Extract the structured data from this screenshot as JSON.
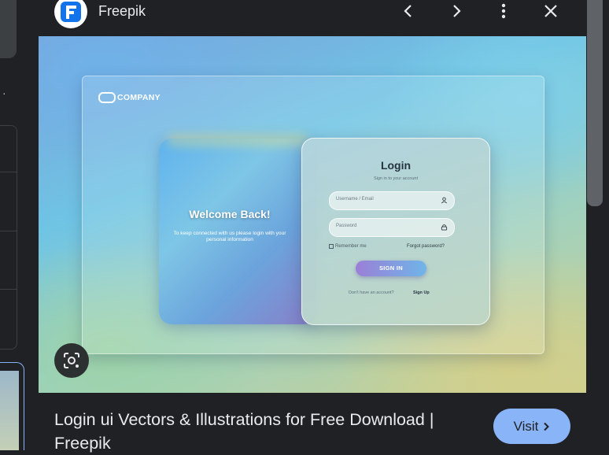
{
  "source": {
    "site_name": "Freepik",
    "favicon": "freepik-logo-icon",
    "brand_color": "#1273eb"
  },
  "toolbar": {
    "prev_icon": "chevron-left-icon",
    "next_icon": "chevron-right-icon",
    "more_icon": "more-vert-icon",
    "close_icon": "close-icon"
  },
  "preview_image": {
    "company": "COMPANY",
    "welcome_title": "Welcome Back!",
    "welcome_sub": "To keep connected with us please login with your personal information",
    "login_title": "Login",
    "login_sub": "Sign in to your account",
    "username_placeholder": "Username / Email",
    "password_placeholder": "Password",
    "remember_me": "Remember me",
    "forgot_password": "Forgot password?",
    "sign_in": "SIGN IN",
    "no_account": "Don't have an account?",
    "sign_up": "Sign Up"
  },
  "result": {
    "title": "Login ui Vectors & Illustrations for Free Download | Freepik",
    "visit_label": "Visit",
    "accent": "#8ab4f8"
  },
  "lens_icon": "google-lens-icon"
}
